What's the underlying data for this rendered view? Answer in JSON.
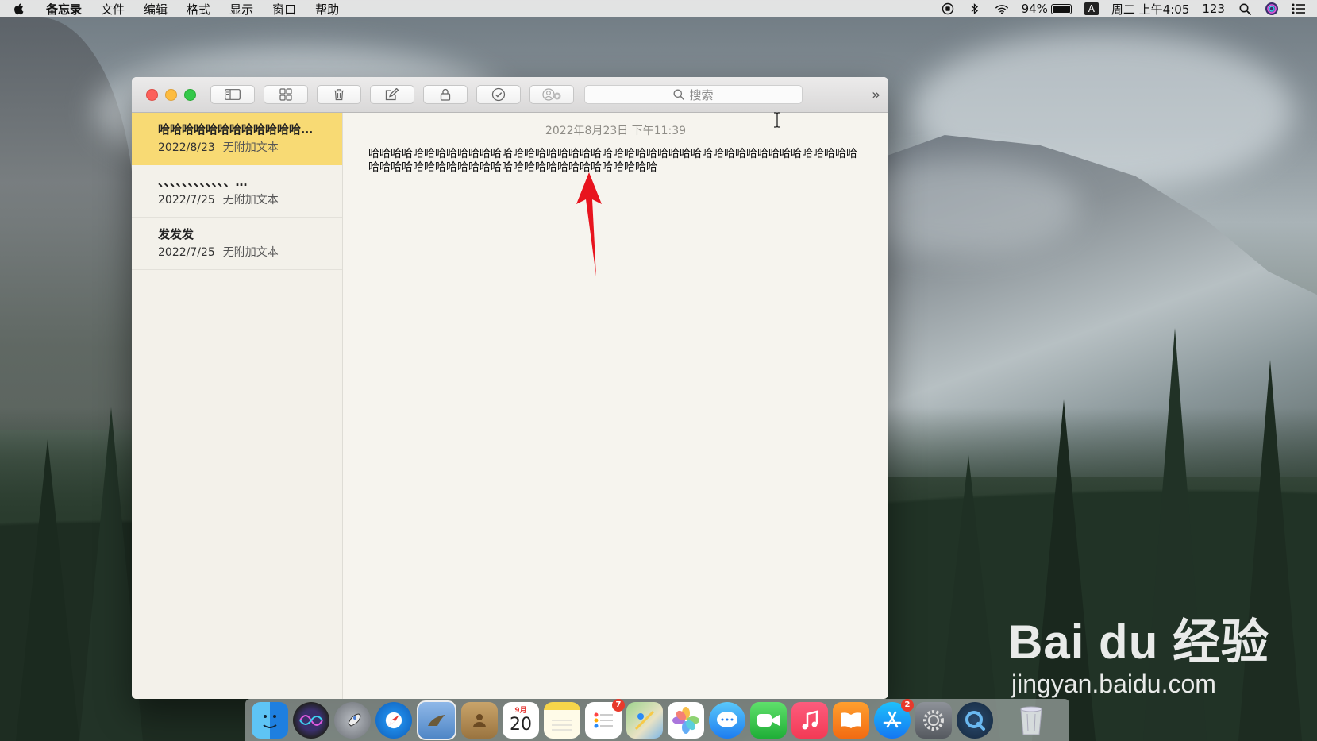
{
  "menubar": {
    "app_name": "备忘录",
    "menus": [
      "文件",
      "编辑",
      "格式",
      "显示",
      "窗口",
      "帮助"
    ],
    "battery_percent": "94%",
    "battery_level": 0.94,
    "clock": "周二 上午4:05",
    "input_extra": "123",
    "input_method": "A"
  },
  "toolbar": {
    "search_placeholder": "搜索",
    "icons": [
      "sidebar-icon",
      "grid-icon",
      "trash-icon",
      "compose-icon",
      "lock-icon",
      "checklist-icon",
      "add-people-icon"
    ]
  },
  "notes": [
    {
      "title": "哈哈哈哈哈哈哈哈哈哈哈哈哈哈哈哈哈…",
      "date": "2022/8/23",
      "preview": "无附加文本",
      "selected": true
    },
    {
      "title": "、、、、、、、、、、、、…",
      "date": "2022/7/25",
      "preview": "无附加文本",
      "selected": false
    },
    {
      "title": "发发发",
      "date": "2022/7/25",
      "preview": "无附加文本",
      "selected": false
    }
  ],
  "editor": {
    "timestamp": "2022年8月23日 下午11:39",
    "body": "哈哈哈哈哈哈哈哈哈哈哈哈哈哈哈哈哈哈哈哈哈哈哈哈哈哈哈哈哈哈哈哈哈哈哈哈哈哈哈哈哈哈哈哈哈哈哈哈哈哈哈哈哈哈哈哈哈哈哈哈哈哈哈哈哈哈哈哈哈哈"
  },
  "dock": {
    "apps": [
      "Finder",
      "Siri",
      "Launchpad",
      "Safari",
      "Mail",
      "Contacts",
      "Calendar",
      "Notes",
      "Reminders",
      "Maps",
      "Photos",
      "Messages",
      "FaceTime",
      "Music",
      "Books",
      "App Store",
      "System Preferences",
      "QuickTime"
    ],
    "calendar_month": "9月",
    "calendar_day": "20",
    "reminders_badge": "7",
    "appstore_badge": "2"
  },
  "watermark": {
    "main": "Bai du 经验",
    "sub": "jingyan.baidu.com"
  },
  "colors": {
    "selected_note": "#f8da74",
    "close": "#fc605b",
    "minimize": "#fdbc40",
    "zoom": "#34c84a",
    "arrow": "#e8141e"
  }
}
